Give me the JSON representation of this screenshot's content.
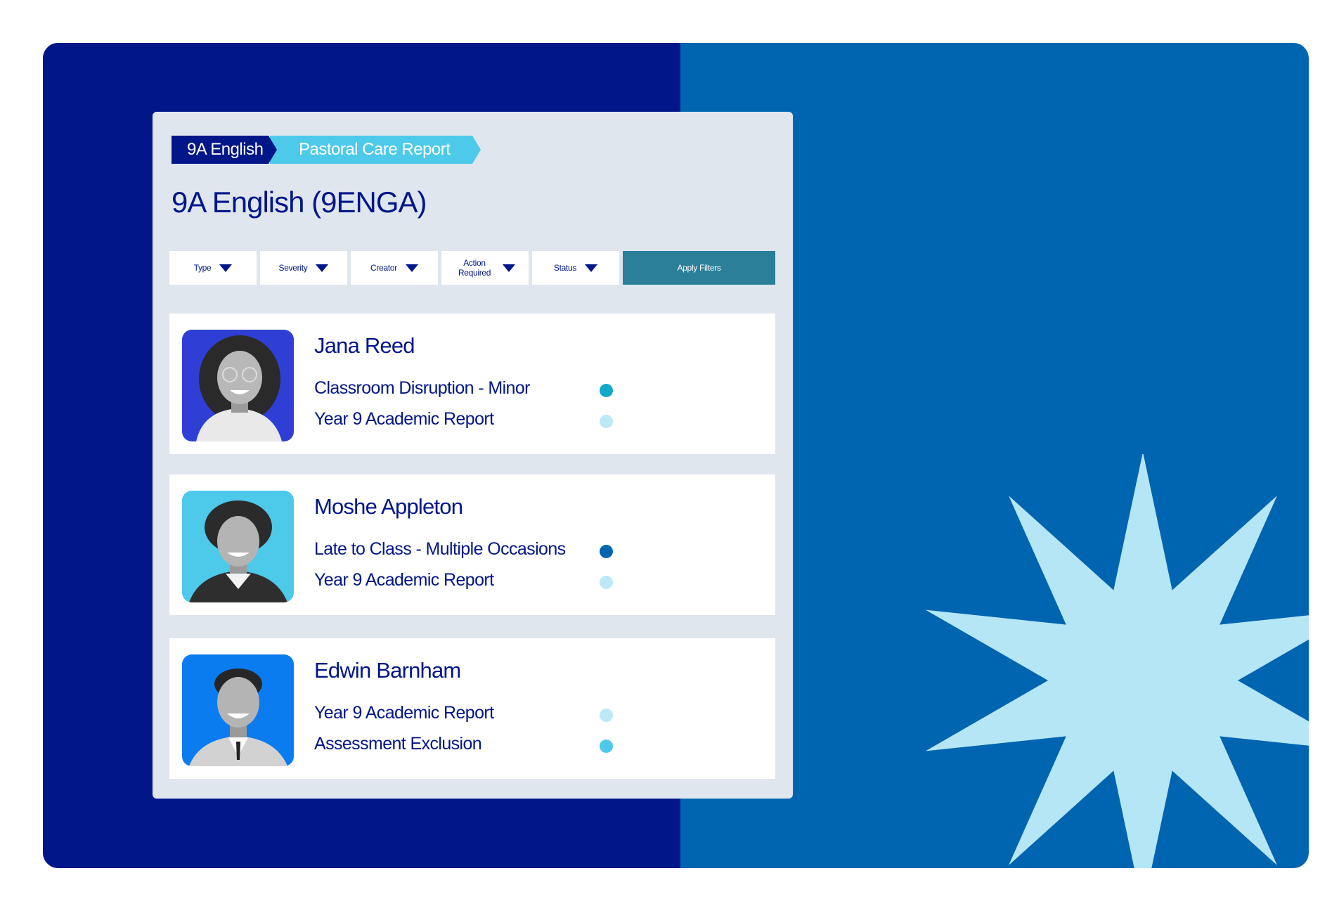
{
  "breadcrumb": [
    "9A English",
    "Pastoral Care Report"
  ],
  "page_title": "9A English (9ENGA)",
  "filters": [
    "Type",
    "Severity",
    "Creator",
    "Action Required",
    "Status"
  ],
  "apply_label": "Apply Filters",
  "colors": {
    "navy": "#001689",
    "blue": "#0065b0",
    "panel": "#e0e6ee",
    "crumb_active": "#4dc9ea",
    "apply": "#2b7f99",
    "star": "#b5e6f5"
  },
  "students": [
    {
      "name": "Jana Reed",
      "avatar_bg": "#2f3fd6",
      "reports": [
        {
          "title": "Classroom Disruption - Minor",
          "dot": "#12a9c9"
        },
        {
          "title": "Year 9 Academic Report",
          "dot": "#bde9f7"
        }
      ]
    },
    {
      "name": "Moshe Appleton",
      "avatar_bg": "#4dc9ea",
      "reports": [
        {
          "title": "Late to Class - Multiple Occasions",
          "dot": "#0065b0"
        },
        {
          "title": "Year 9 Academic Report",
          "dot": "#bde9f7"
        }
      ]
    },
    {
      "name": "Edwin Barnham",
      "avatar_bg": "#0a7cf0",
      "reports": [
        {
          "title": "Year 9 Academic Report",
          "dot": "#bde9f7"
        },
        {
          "title": "Assessment Exclusion",
          "dot": "#4dc9ea"
        }
      ]
    }
  ]
}
